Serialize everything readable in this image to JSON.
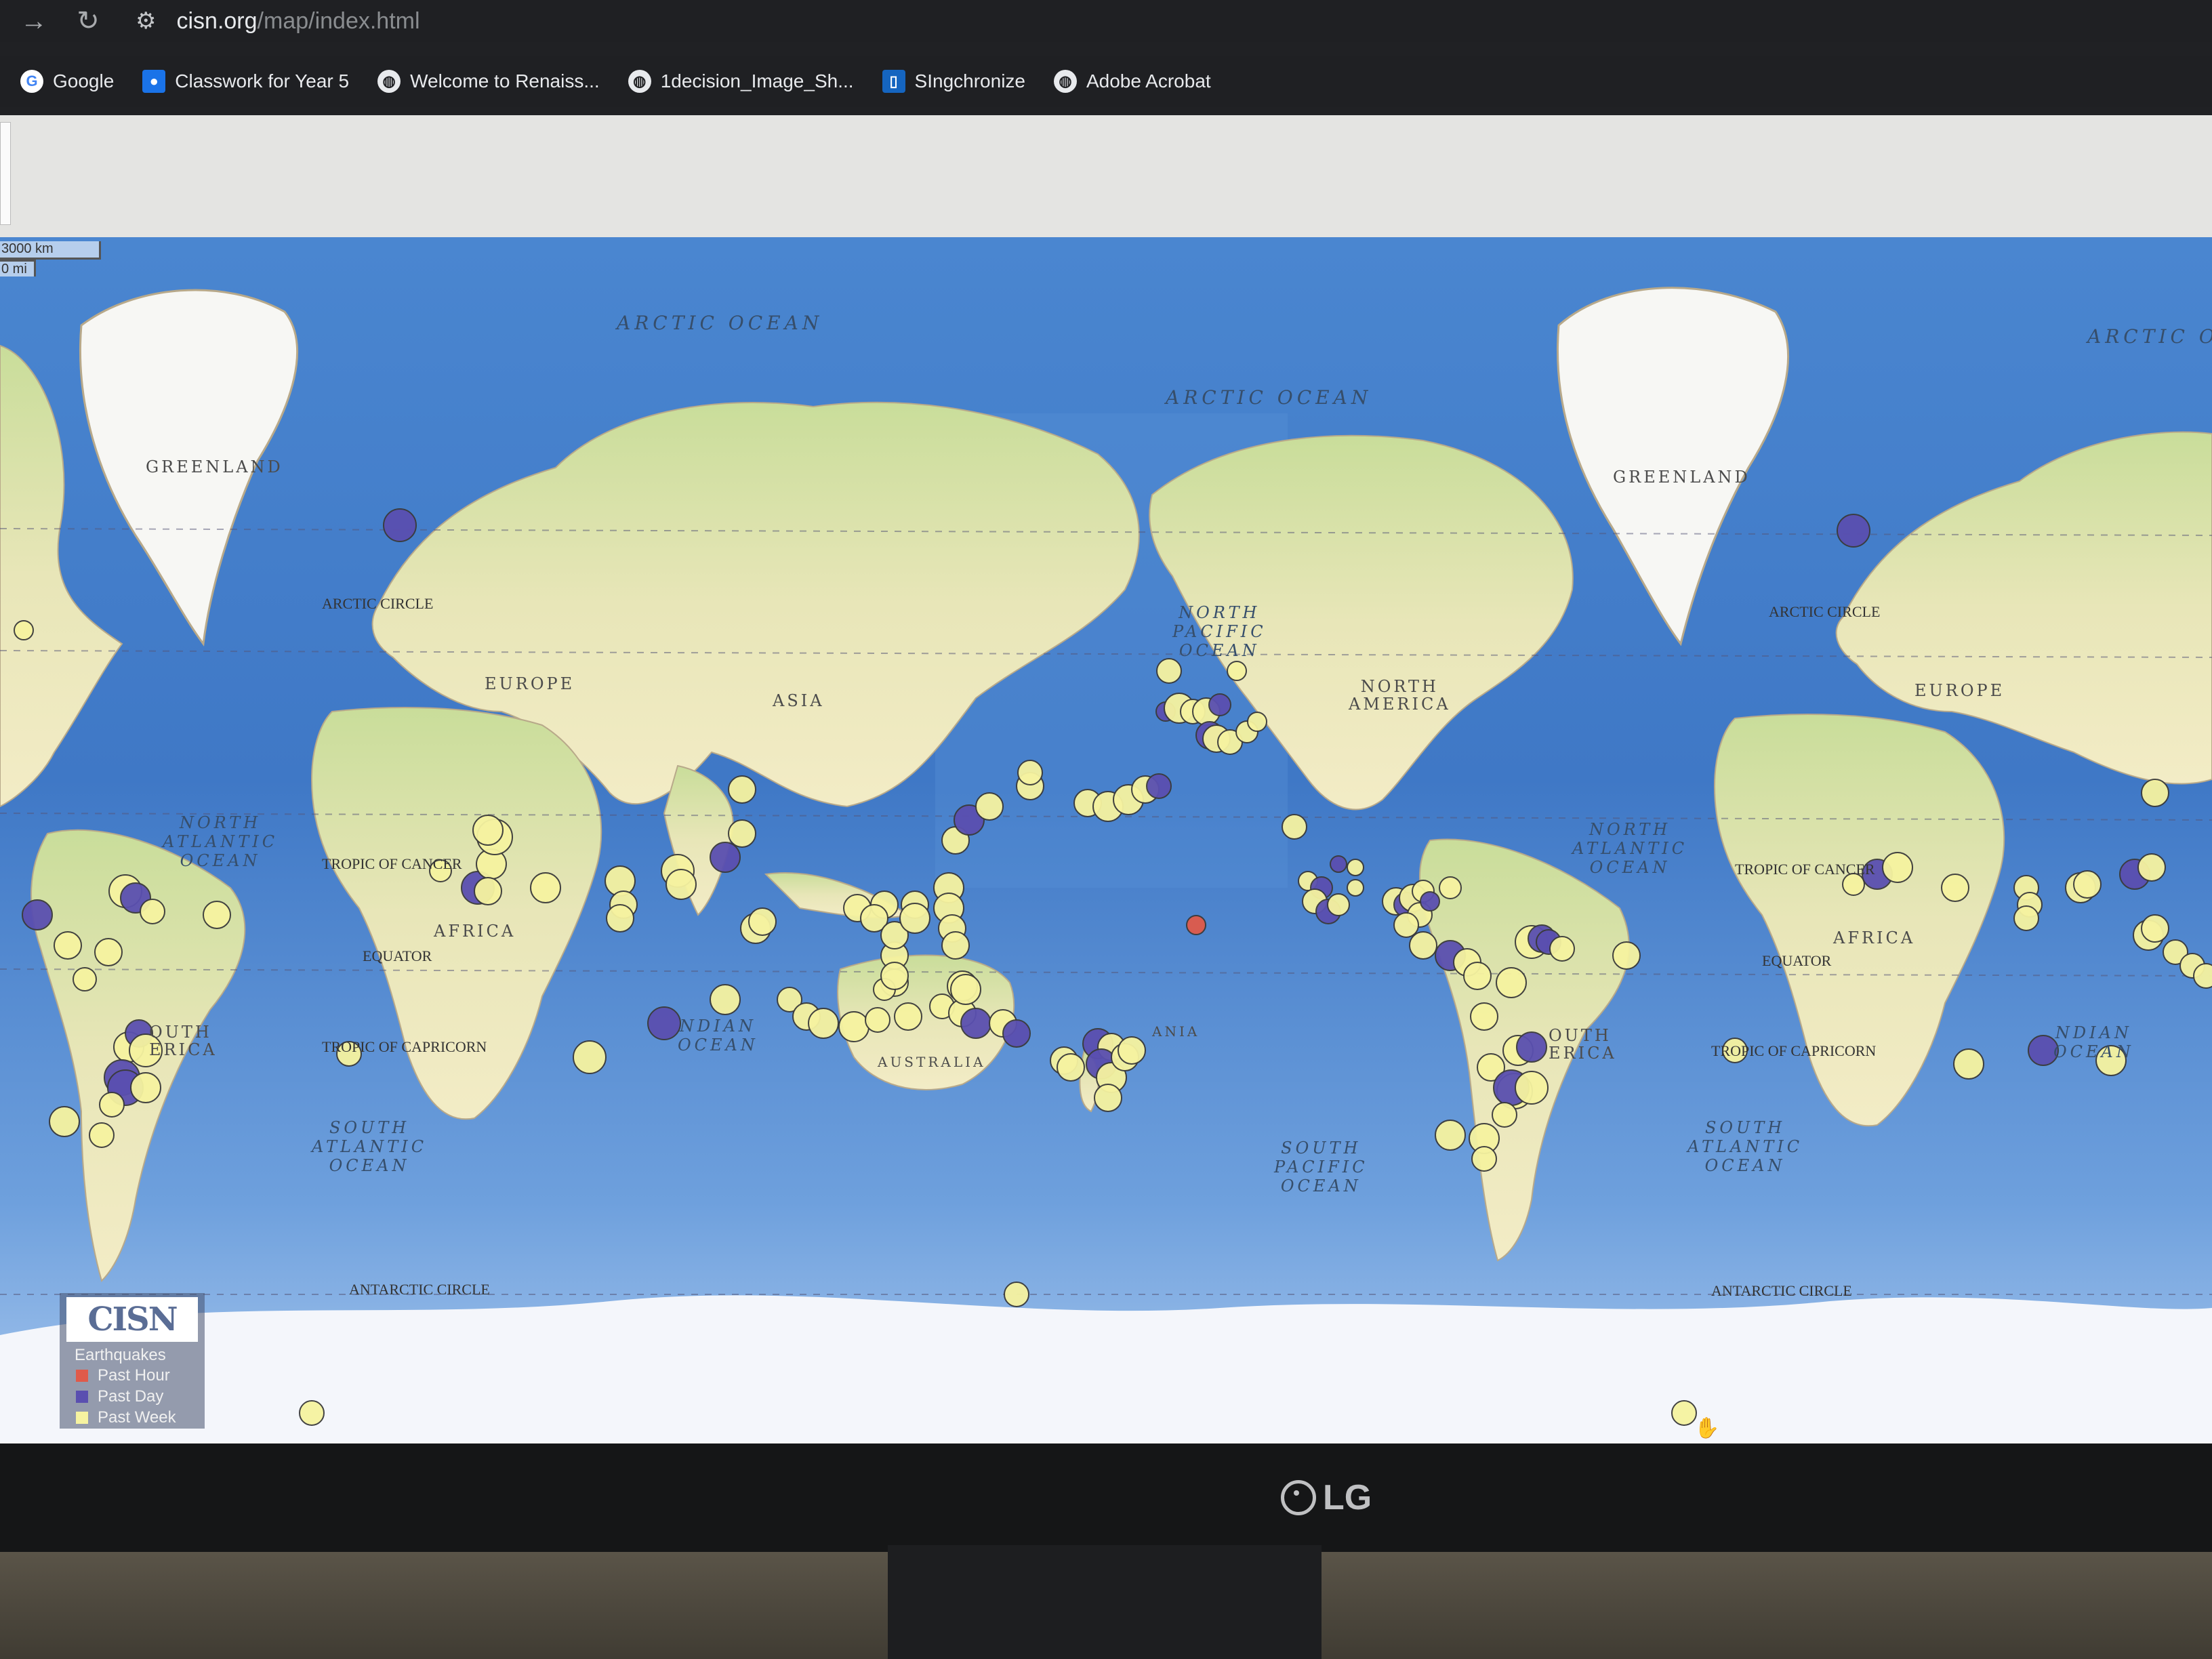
{
  "browser": {
    "url_host": "cisn.org",
    "url_path": "/map/index.html",
    "bookmarks": [
      {
        "label": "Google",
        "icon": "google-icon"
      },
      {
        "label": "Classwork for Year 5",
        "icon": "classroom-icon"
      },
      {
        "label": "Welcome to Renaiss...",
        "icon": "globe-icon"
      },
      {
        "label": "1decision_Image_Sh...",
        "icon": "globe-icon"
      },
      {
        "label": "SIngchronize",
        "icon": "sync-icon"
      },
      {
        "label": "Adobe Acrobat",
        "icon": "globe-icon"
      }
    ]
  },
  "map": {
    "scale_km": "3000 km",
    "scale_mi": "0 mi",
    "ocean_labels": {
      "arctic_left": "ARCTIC OCEAN",
      "arctic_center": "ARCTIC OCEAN",
      "arctic_right": "ARCTIC OC",
      "north_pacific": [
        "NORTH",
        "PACIFIC",
        "OCEAN"
      ],
      "south_pacific": [
        "SOUTH",
        "PACIFIC",
        "OCEAN"
      ],
      "north_atlantic_left": [
        "NORTH",
        "ATLANTIC",
        "OCEAN"
      ],
      "north_atlantic_right": [
        "NORTH",
        "ATLANTIC",
        "OCEAN"
      ],
      "south_atlantic_left": [
        "SOUTH",
        "ATLANTIC",
        "OCEAN"
      ],
      "south_atlantic_right": [
        "SOUTH",
        "ATLANTIC",
        "OCEAN"
      ],
      "indian_left": [
        "NDIAN",
        "OCEAN"
      ],
      "indian_right": [
        "NDIAN",
        "OCEAN"
      ]
    },
    "land_labels": {
      "greenland_left": "GREENLAND",
      "greenland_right": "GREENLAND",
      "europe_left": "EUROPE",
      "europe_right": "EUROPE",
      "asia": "ASIA",
      "africa_left": "AFRICA",
      "africa_right": "AFRICA",
      "north_america": [
        "NORTH",
        "AMERICA"
      ],
      "south_america_left": [
        "OUTH",
        "ERICA"
      ],
      "south_america_right": [
        "OUTH",
        "ERICA"
      ],
      "australia": "AUSTRALIA",
      "oceania": "ANIA"
    },
    "line_labels": {
      "arctic_circle_left": "ARCTIC CIRCLE",
      "arctic_circle_right": "ARCTIC CIRCLE",
      "tropic_cancer_left": "TROPIC OF CANCER",
      "tropic_cancer_right": "TROPIC OF CANCER",
      "equator_left": "EQUATOR",
      "equator_right": "EQUATOR",
      "tropic_capricorn_left": "TROPIC OF CAPRICORN",
      "tropic_capricorn_right": "TROPIC OF CAPRICORN",
      "antarctic_left": "ANTARCTIC CIRCLE",
      "antarctic_right": "ANTARCTIC CIRCLE"
    },
    "earthquake_colors": {
      "hour": "#e05a4a",
      "day": "#5a4fb0",
      "week": "#f6f3a0"
    }
  },
  "legend": {
    "logo": "CISN",
    "title": "Earthquakes",
    "items": [
      {
        "label": "Past Hour",
        "color": "#e05a4a"
      },
      {
        "label": "Past Day",
        "color": "#5a4fb0"
      },
      {
        "label": "Past Week",
        "color": "#f6f3a0"
      }
    ]
  },
  "monitor": {
    "brand": "LG"
  }
}
